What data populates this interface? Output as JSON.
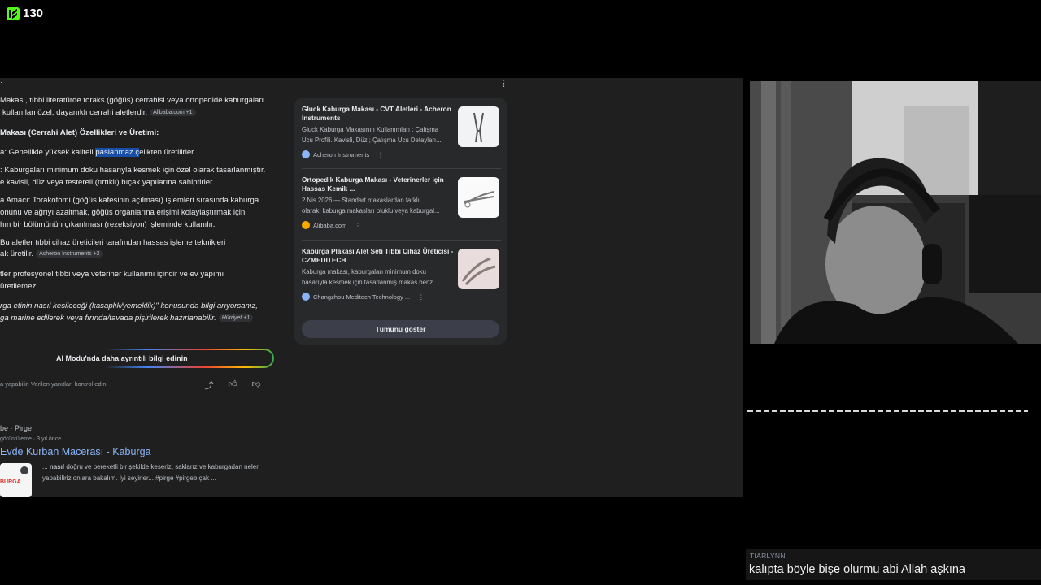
{
  "stream": {
    "viewer_count": "130",
    "logo_icon": "kick-logo-icon"
  },
  "ai_overview": {
    "lines": [
      {
        "text": "Makası, tıbbi literatürde toraks (göğüs) cerrahisi veya ortopedide kaburgaları"
      },
      {
        "text": "kullanılan özel, dayanıklı cerrahi aletlerdir.",
        "chip": "Alibaba.com +1"
      },
      {
        "text": "Makası (Cerrahi Alet) Özellikleri ve Üretimi:"
      },
      {
        "pre": "a: Genellikle yüksek kaliteli ",
        "highlight": "paslanmaz ç",
        "post": "elikten üretilirler."
      },
      {
        "text": ": Kaburgaları minimum doku hasarıyla kesmek için özel olarak tasarlanmıştır."
      },
      {
        "text": "e kavisli, düz veya testereli (tırtıklı) bıçak yapılarına sahiptirler."
      },
      {
        "text": "a Amacı: Torakotomi (göğüs kafesinin açılması) işlemleri sırasında kaburga"
      },
      {
        "text": "onunu ve ağrıyı azaltmak, göğüs organlarına erişimi kolaylaştırmak için"
      },
      {
        "text": "hın bir bölümünün çıkarılması (rezeksiyon) işleminde kullanılır."
      },
      {
        "text": "Bu aletler tıbbi cihaz üreticileri tarafından hassas işleme teknikleri"
      },
      {
        "text": "ak üretilir.",
        "chip": "Acheron Instruments +2"
      },
      {
        "text": "tler profesyonel tıbbi veya veteriner kullanımı içindir ve ev yapımı"
      },
      {
        "text": "üretilemez."
      },
      {
        "text": "rga etinin nasıl kesileceği (kasaplık/yemeklik)\" konusunda bilgi arıyorsanız,"
      },
      {
        "text": "ga marine edilerek veya fırında/tavada pişirilerek hazırlanabilir.",
        "chip": "Hürriyet +1"
      }
    ],
    "ai_mode_button": "AI Modu'nda daha ayrıntılı bilgi edinin",
    "disclaimer": "a yapabilir. Verilen yanıtları kontrol edin"
  },
  "sources": {
    "items": [
      {
        "title": "Gluck Kaburga Makası - CVT Aletleri - Acheron Instruments",
        "desc": [
          "Gluck Kaburga Makasının Kullanımları ; Çalışma",
          "Ucu Profili. Kavisli, Düz ; Çalışma Ucu Detayları..."
        ],
        "site": "Acheron Instruments",
        "fav_color": "#8ab4f8"
      },
      {
        "title": "Ortopedik Kaburga Makası - Veterinerler için Hassas Kemik ...",
        "desc": [
          "2 Nis 2026 — Standart makaslardan farklı",
          "olarak, kaburga makasları oluklu veya kaburgal..."
        ],
        "site": "Alibaba.com",
        "fav_color": "#f9ab00"
      },
      {
        "title": "Kaburga Plakası Alet Seti Tıbbi Cihaz Üreticisi - CZMEDITECH",
        "desc": [
          "Kaburga makası, kaburgaları minimum doku",
          "hasarıyla kesmek için tasarlanmış makas benz..."
        ],
        "site": "Changzhou Meditech Technology ...",
        "fav_color": "#8ab4f8"
      }
    ],
    "show_all": "Tümünü göster"
  },
  "video_result": {
    "source": "be · Pirge",
    "meta": "görüntüleme · 3 yıl önce",
    "title": "Evde Kurban Macerası - Kaburga",
    "thumb_text": "BURGA",
    "snippet_1_pre": "... ",
    "snippet_1_bold": "nasıl",
    "snippet_1_post": " doğru ve bereketli bir şekilde keseriz, saklarız ve kaburgadan neler",
    "snippet_2": "yapabiliriz onlara bakalım. İyi seyirler... #pirge #pirgebıçak ..."
  },
  "chat": {
    "username": "TIARLYNN",
    "message": "kalıpta böyle bişe olurmu abi Allah aşkına"
  }
}
